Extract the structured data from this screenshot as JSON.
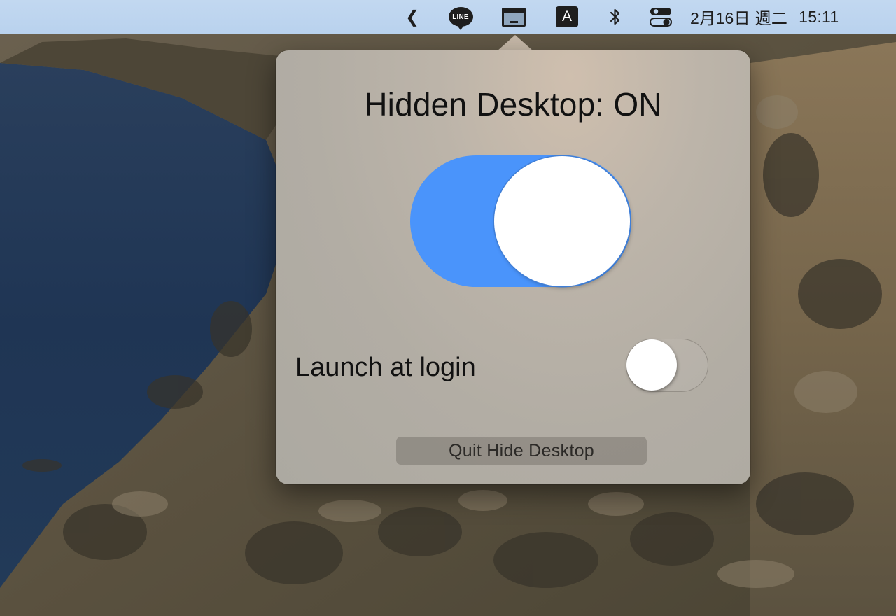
{
  "menubar": {
    "items": [
      {
        "name": "menu-overflow-chevron",
        "glyph": "❮"
      },
      {
        "name": "line-app",
        "label": "LINE"
      },
      {
        "name": "hide-desktop",
        "icon": "window-icon"
      },
      {
        "name": "input-source",
        "label": "A"
      },
      {
        "name": "bluetooth",
        "icon": "bluetooth-icon"
      },
      {
        "name": "control-center",
        "icon": "toggles-icon"
      }
    ],
    "clock": {
      "date": "2月16日 週二",
      "time": "15:11"
    }
  },
  "popover": {
    "title": "Hidden Desktop: ON",
    "hidden_desktop_toggle": {
      "state": "on",
      "color": "#4a94fb"
    },
    "launch_at_login": {
      "label": "Launch at login",
      "state": "off"
    },
    "quit_label": "Quit Hide Desktop"
  }
}
